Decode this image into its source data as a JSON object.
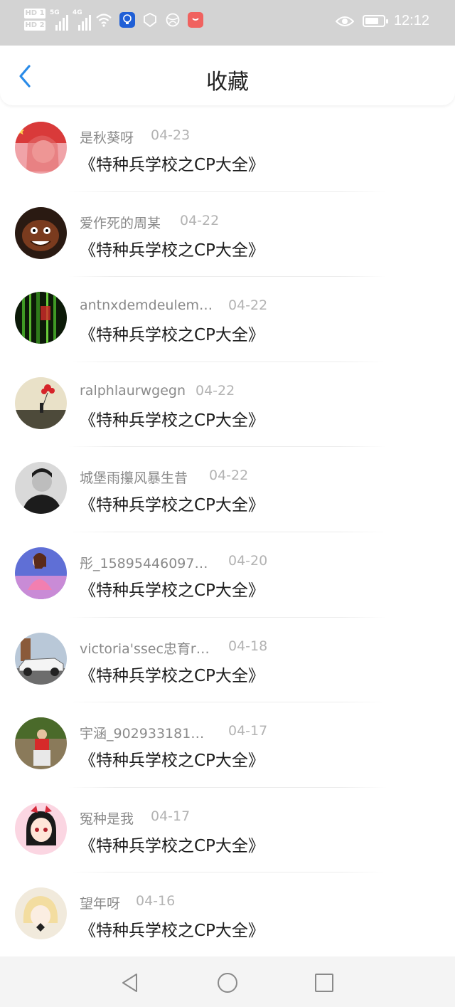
{
  "status_bar": {
    "network_badges": [
      "HD 1",
      "HD 2"
    ],
    "network_labels": [
      "5G",
      "4G"
    ],
    "time": "12:12"
  },
  "header": {
    "title": "收藏"
  },
  "favorites": [
    {
      "username": "是秋葵呀",
      "date": "04-23",
      "book": "《特种兵学校之CP大全》"
    },
    {
      "username": "爱作死的周某",
      "date": "04-22",
      "book": "《特种兵学校之CP大全》"
    },
    {
      "username": "antnxdemdeulem…",
      "date": "04-22",
      "book": "《特种兵学校之CP大全》"
    },
    {
      "username": "ralphlaurwgegn",
      "date": "04-22",
      "book": "《特种兵学校之CP大全》"
    },
    {
      "username": "城堡雨攥风暴生昔",
      "date": "04-22",
      "book": "《特种兵学校之CP大全》"
    },
    {
      "username": "彤_15895446097…",
      "date": "04-20",
      "book": "《特种兵学校之CP大全》"
    },
    {
      "username": "victoria'ssec忠育r…",
      "date": "04-18",
      "book": "《特种兵学校之CP大全》"
    },
    {
      "username": "宇涵_902933181…",
      "date": "04-17",
      "book": "《特种兵学校之CP大全》"
    },
    {
      "username": "冤种是我",
      "date": "04-17",
      "book": "《特种兵学校之CP大全》"
    },
    {
      "username": "望年呀",
      "date": "04-16",
      "book": "《特种兵学校之CP大全》"
    }
  ],
  "colors": {
    "accent": "#2a8be8",
    "status_bar_bg": "#d3d3d3",
    "nav_bar_bg": "#f4f4f4",
    "username": "#8a8a8a",
    "date": "#b3b3b3"
  },
  "icons": {
    "back": "chevron-left-icon",
    "nav_back": "triangle-back-icon",
    "nav_home": "circle-home-icon",
    "nav_recents": "square-recents-icon"
  }
}
